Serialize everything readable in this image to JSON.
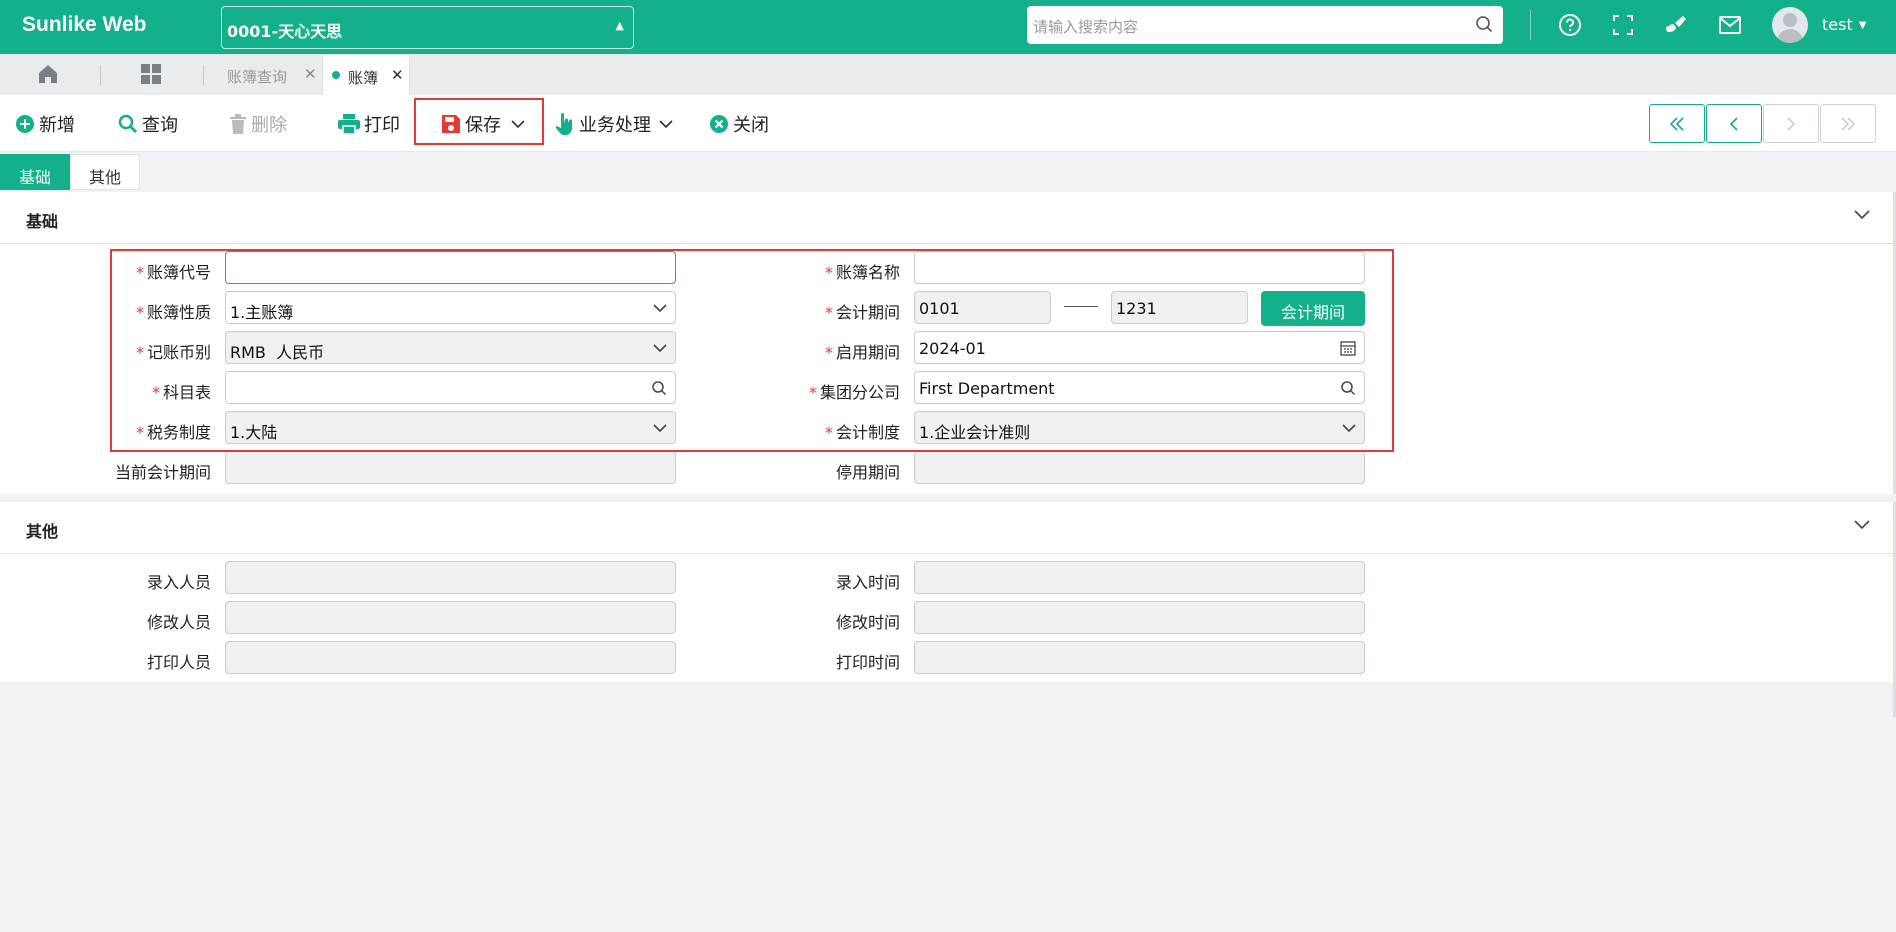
{
  "header": {
    "logo": "Sunlike Web",
    "company": "0001-天心天思",
    "search_placeholder": "请输入搜索内容",
    "user_name": "test"
  },
  "tabs": [
    {
      "label": "账簿查询",
      "active": false
    },
    {
      "label": "账簿",
      "active": true
    }
  ],
  "toolbar": {
    "add": "新增",
    "query": "查询",
    "delete": "删除",
    "print": "打印",
    "save": "保存",
    "business": "业务处理",
    "close": "关闭"
  },
  "form_tabs": [
    "基础",
    "其他"
  ],
  "sections": {
    "basic_title": "基础",
    "other_title": "其他"
  },
  "basic": {
    "book_code": {
      "label": "账簿代号",
      "value": ""
    },
    "book_name": {
      "label": "账簿名称",
      "value": ""
    },
    "book_nature": {
      "label": "账簿性质",
      "value": "1.主账簿"
    },
    "acct_period": {
      "label": "会计期间",
      "from": "0101",
      "to": "1231",
      "button": "会计期间"
    },
    "currency": {
      "label": "记账币别",
      "value": "RMB  人民币"
    },
    "start_period": {
      "label": "启用期间",
      "value": "2024-01"
    },
    "subject_table": {
      "label": "科目表",
      "value": ""
    },
    "group_company": {
      "label": "集团分公司",
      "value": "First Department"
    },
    "tax_system": {
      "label": "税务制度",
      "value": "1.大陆"
    },
    "acct_system": {
      "label": "会计制度",
      "value": "1.企业会计准则"
    },
    "current_period": {
      "label": "当前会计期间",
      "value": ""
    },
    "stop_period": {
      "label": "停用期间",
      "value": ""
    }
  },
  "other": {
    "entered_by": {
      "label": "录入人员",
      "value": ""
    },
    "entered_time": {
      "label": "录入时间",
      "value": ""
    },
    "modified_by": {
      "label": "修改人员",
      "value": ""
    },
    "modified_time": {
      "label": "修改时间",
      "value": ""
    },
    "printed_by": {
      "label": "打印人员",
      "value": ""
    },
    "printed_time": {
      "label": "打印时间",
      "value": ""
    }
  },
  "colors": {
    "accent": "#13b08a",
    "highlight": "#e53935"
  }
}
